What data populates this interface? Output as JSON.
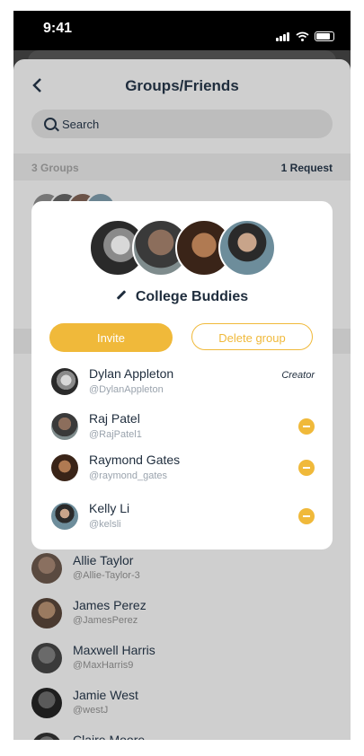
{
  "status_bar": {
    "time": "9:41"
  },
  "header": {
    "title": "Groups/Friends",
    "back_icon": "chevron-left-icon"
  },
  "search": {
    "placeholder": "Search"
  },
  "section": {
    "groups_count": "3 Groups",
    "requests": "1 Request"
  },
  "modal": {
    "group_name": "College Buddies",
    "invite_label": "Invite",
    "delete_label": "Delete group",
    "members": [
      {
        "name": "Dylan Appleton",
        "handle": "@DylanAppleton",
        "role": "Creator"
      },
      {
        "name": "Raj Patel",
        "handle": "@RajPatel1"
      },
      {
        "name": "Raymond Gates",
        "handle": "@raymond_gates"
      },
      {
        "name": "Kelly Li",
        "handle": "@kelsli"
      }
    ]
  },
  "friends": [
    {
      "name": "Allie Taylor",
      "handle": "@Allie-Taylor-3"
    },
    {
      "name": "James Perez",
      "handle": "@JamesPerez"
    },
    {
      "name": "Maxwell Harris",
      "handle": "@MaxHarris9"
    },
    {
      "name": "Jamie West",
      "handle": "@westJ"
    },
    {
      "name": "Claire Moore",
      "handle": ""
    }
  ],
  "colors": {
    "accent": "#f0b93a",
    "text": "#1f2d3d",
    "overlay": "#cfcfcf"
  }
}
